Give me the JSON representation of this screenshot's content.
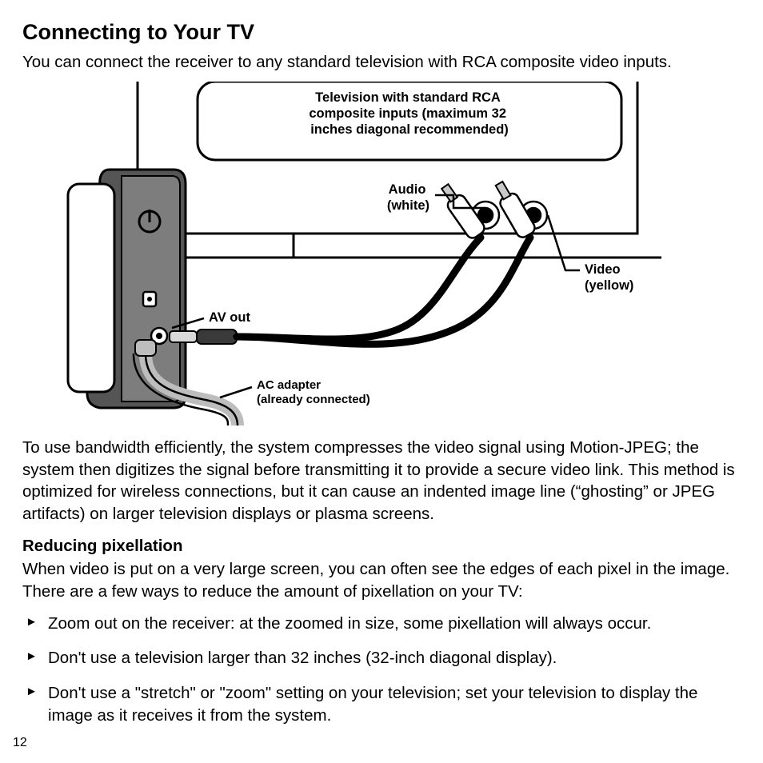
{
  "heading": "Connecting to Your TV",
  "intro": "You can connect the receiver to any standard television with RCA composite video inputs.",
  "figure": {
    "tv_label_line1": "Television with standard RCA",
    "tv_label_line2": "composite inputs (maximum 32",
    "tv_label_line3": "inches diagonal recommended)",
    "audio_label_line1": "Audio",
    "audio_label_line2": "(white)",
    "video_label_line1": "Video",
    "video_label_line2": "(yellow)",
    "av_out_label": "AV out",
    "ac_adapter_line1": "AC adapter",
    "ac_adapter_line2": "(already connected)"
  },
  "bandwidth_para": "To use bandwidth efficiently, the system compresses the video signal using Motion-JPEG; the system then digitizes the signal before transmitting it to provide a secure video link. This method is optimized for wireless connections, but it can cause an indented image line (“ghosting” or JPEG artifacts) on larger television displays or plasma screens.",
  "pixellation_heading": "Reducing pixellation",
  "pixellation_intro": "When video is put on a very large screen, you can often see the edges of each pixel in the image. There are a few ways to reduce the amount of pixellation on your TV:",
  "bullets": [
    "Zoom out on the receiver: at the zoomed in size, some pixellation will always occur.",
    "Don't use a television larger than 32 inches (32-inch diagonal display).",
    "Don't use a \"stretch\" or \"zoom\" setting on your television; set your television to display the image as it receives it from the system."
  ],
  "page_number": "12"
}
